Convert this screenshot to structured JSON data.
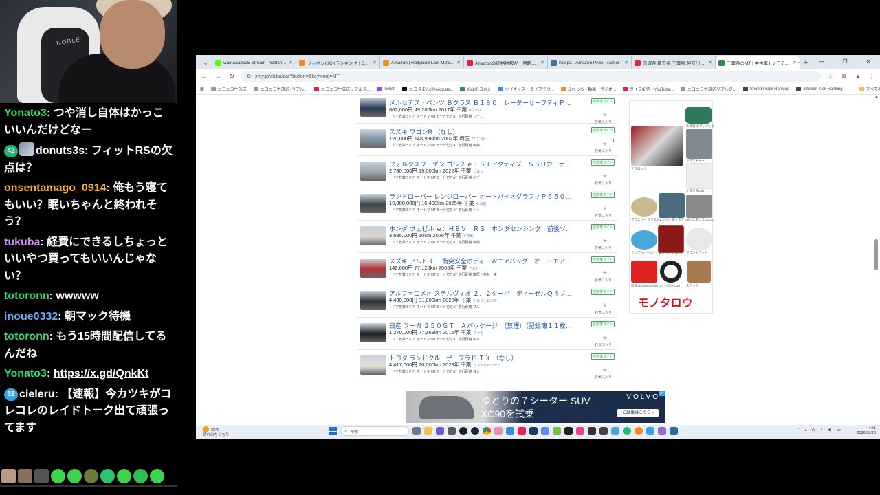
{
  "chat": {
    "messages": [
      {
        "user": "Yonato3",
        "user_color": "#3bd86b",
        "text": "つや消し自体はかっこいいんだけどなー"
      },
      {
        "badge": "42",
        "user": "donuts3s",
        "user_color": "#ffffff",
        "text": "フィットRSの欠点は？"
      },
      {
        "user": "onsentamago_0914",
        "user_color": "#f4a93a",
        "text": "俺もう寝てもいい？眠いちゃんと終われそう？"
      },
      {
        "user": "tukuba",
        "user_color": "#c88bf5",
        "text": "経費にできるしちょっといいやつ買ってもいいんじゃない？"
      },
      {
        "user": "totoronn",
        "user_color": "#3bd86b",
        "text": "wwwww"
      },
      {
        "user": "inoue0332",
        "user_color": "#6da6f5",
        "text": "朝マック待機"
      },
      {
        "user": "totoronn",
        "user_color": "#3bd86b",
        "text": "もう15時間配信してるんだね"
      },
      {
        "user": "Yonato3",
        "user_color": "#3bd86b",
        "text": "https://x.gd/QnkKt",
        "is_link": true
      },
      {
        "badge": "32",
        "user": "cieleru",
        "user_color": "#ffffff",
        "text": "【速報】今カツキがコレコレのレイドトーク出て頑張ってます"
      }
    ]
  },
  "browser": {
    "tabs": [
      {
        "title": "wainaaa2525 Stream - Watch L...",
        "color": "#53fc18"
      },
      {
        "title": "ジャポンKICKランキング | Shobon K...",
        "color": "#f08a24"
      },
      {
        "title": "Amazon | Hollyland Lark M2S...",
        "color": "#f08a24"
      },
      {
        "title": "Amazonの価格推移が一目瞭然...",
        "color": "#d7263d"
      },
      {
        "title": "Keepa - Amazon Price Tracker",
        "color": "#3c6e9e"
      },
      {
        "title": "茨城県 埼玉県 千葉県 神奈川県...",
        "color": "#d7263d"
      },
      {
        "title": "千葉県のMT | 中古車 | ジモティー",
        "color": "#2a8c4a"
      }
    ],
    "url": "jmty.jp/chiba/car?button=&keyword=MT",
    "bookmarks": [
      "ニコニコ生放送",
      "ニコニコ生放送 (リアル...",
      "ニコニコ生放送リアルタ...",
      "Twitch",
      "ニコタまん(@nikorats...",
      "Kickのコメン",
      "ツイキャス・ライブでつ...",
      "ふわっち - 動画・ラジオ...",
      "ライブ配信 - YouTube...",
      "ニコニコ生放送リアルタ...",
      "Shobon Kick Ranking",
      "Shobon Kick Ranking",
      "すべてのブックマーク"
    ]
  },
  "listings": [
    {
      "title": "メルセデス・ベンツ Ｂクラス Ｂ１８０　レーダーセーフティＰＫＧ...",
      "price": "802,000円",
      "detail": "49,200km 2017年 千葉",
      "sub": "Bクラス",
      "specs": "ドア枚数  5ドア  オートマ  MTモード付きAT  走行距離  レー...",
      "tag": "自動車ライト",
      "fav": "お気に入り",
      "thumb": "#2b3a55"
    },
    {
      "title": "スズキ ワゴンR （なし）",
      "price": "120,000円",
      "detail": "148,998km 2002年 埼玉",
      "sub": "ワゴンR",
      "specs": "ドア枚数  5ドア  オートマ  MTモード付きAT  走行距離  車検",
      "tag": "自動車ライト",
      "fav": "お気に入り",
      "thumb": "#7f8fa3",
      "fav_count": "1"
    },
    {
      "title": "フォルクスワーゲン ゴルフ ｅＴＳＩアクティブ　ＳＳＤカーナビ　...",
      "price": "2,780,000円",
      "detail": "19,000km 2022年 千葉",
      "sub": "ゴルフ",
      "specs": "ドア枚数  5ドア  オートマ  MTモード付きAT  走行距離  ボデ",
      "tag": "自動車ライト",
      "fav": "お気に入り",
      "thumb": "#9aa4ad"
    },
    {
      "title": "ランドローバー レンジローバー オートバイオグラフィＰ５５０ｅス...",
      "price": "19,800,000円",
      "detail": "16,400km 2025年 千葉",
      "sub": "その他",
      "specs": "ドア枚数  5ドア  オートマ  MTモード付きAT  走行距離  ヘッ",
      "tag": "自動車ライト",
      "fav": "お気に入り",
      "thumb": "#3f4a4f"
    },
    {
      "title": "ホンダ ヴェゼル ｅ：ＨＥＶ　ＲＳ　ホンダセンシング　前後ソナー...",
      "price": "3,695,000円",
      "detail": "10km 2026年 千葉",
      "sub": "その他",
      "specs": "ドア枚数  5ドア  オートマ  MTモード付きAT  走行距離  車検",
      "tag": "自動車ライト",
      "fav": "お気に入り",
      "thumb": "#d9d6cf"
    },
    {
      "title": "スズキ アルト Ｇ　衝突安全ボディ　Ｗエアバッグ　オートエアコン...",
      "price": "148,000円",
      "detail": "77,125km 2005年 千葉",
      "sub": "アルト",
      "specs": "ドア枚数  5ドア  オートマ  MTモード付きAT  走行距離  車歴・車齢・車",
      "tag": "自動車ライト",
      "fav": "お気に入り",
      "thumb": "#b8312f"
    },
    {
      "title": "アルファロメオ ステルヴィオ ２．２ターボ　ディーゼルＱ４ヴェロ...",
      "price": "4,480,000円",
      "detail": "31,000km 2023年 千葉",
      "sub": "アルファロメオ",
      "specs": "ドア枚数  5ドア  オートマ  MTモード付きAT  走行距離  ブル",
      "tag": "自動車ライト",
      "fav": "お気に入り",
      "thumb": "#2f3236"
    },
    {
      "title": "日産 フーガ ２５０ＧＴ　Ａパッケージ　（禁煙）（記録簿１１枚）...",
      "price": "1,270,000円",
      "detail": "77,168km 2015年 千葉",
      "sub": "フーガ",
      "specs": "ドア枚数  5ドア  オートマ  MTモード付きAT  走行距離  キャ",
      "tag": "自動車ライト",
      "fav": "お気に入り",
      "thumb": "#1f2226"
    },
    {
      "title": "トヨタ ランドクルーザープラド ＴＸ （なし）",
      "price": "4,417,000円",
      "detail": "20,000km 2023年 千葉",
      "sub": "ランドクルーザー",
      "specs": "ドア枚数  5ドア  オートマ  MTモード付きAT  走行距離  ヨン",
      "tag": "自動車ライト",
      "fav": "お気に入り",
      "thumb": "#e4e2dc"
    }
  ],
  "side_ad": {
    "labels": [
      "工具袋 ボディバッグ",
      "シグナチャー",
      "アプロック",
      "イヌジヲLaw",
      "ブラスパー ブラスト",
      "エンジン 組立スタンド",
      "インスタンスEDC01",
      "ランプカバー(Lサイズ)",
      "レプリカ 大和 F1",
      "フロントライト",
      "禁煙 NO SMOKING",
      "Oリング(R122)",
      "ステップ"
    ],
    "logo": "モノタロウ"
  },
  "banner": {
    "line1": "ゆとりの７シーター SUV",
    "line2": "XC90を試乗",
    "brand": "VOLVO",
    "cta": "ご試乗はこちら ›"
  },
  "taskbar": {
    "weather_temp": "23°C",
    "weather_desc": "晴れのちくもり",
    "search_placeholder": "検索",
    "time": "4:51",
    "date": "2026/08/20",
    "tray_ime": "A"
  }
}
